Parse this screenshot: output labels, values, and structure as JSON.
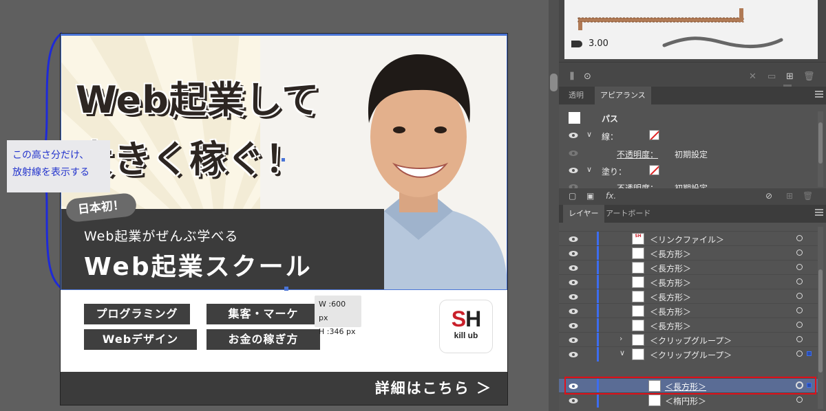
{
  "banner": {
    "headline_line1": "Web起業して",
    "headline_line2": "大きく稼ぐ！",
    "badge": "日本初！",
    "subtext": "Web起業がぜんぶ学べる",
    "school_name": "Web起業スクール",
    "courses": [
      "プログラミング",
      "集客・マーケ",
      "Webデザイン",
      "お金の稼ぎ方"
    ],
    "logo_letters_s": "S",
    "logo_letters_h": "H",
    "logo_sub": "kill ub",
    "details_link": "詳細はこちら ＞"
  },
  "canvas": {
    "size_tooltip_w": "W :600 px",
    "size_tooltip_h": "H :346 px",
    "annotation_line1": "この高さ分だけ、",
    "annotation_line2": "放射線を表示する"
  },
  "brushes": {
    "stroke_size": "3.00"
  },
  "appearance_panel": {
    "tabs": [
      "透明",
      "アピアランス"
    ],
    "active_tab": "アピアランス",
    "object_type": "パス",
    "stroke_label": "線：",
    "opacity_label": "不透明度：",
    "opacity_value": "初期設定",
    "fill_label": "塗り：",
    "opacity2_label": "不透明度：",
    "opacity2_value": "初期設定"
  },
  "layers_panel": {
    "tabs": [
      "レイヤー",
      "アートボード"
    ],
    "active_tab": "レイヤー",
    "rows": [
      {
        "name": "＜リンクファイル＞"
      },
      {
        "name": "＜長方形＞"
      },
      {
        "name": "＜長方形＞"
      },
      {
        "name": "＜長方形＞"
      },
      {
        "name": "＜長方形＞"
      },
      {
        "name": "＜長方形＞"
      },
      {
        "name": "＜長方形＞"
      },
      {
        "name": "＜クリップグループ＞"
      },
      {
        "name": "＜クリップグループ＞"
      },
      {
        "name": "＜長方形＞"
      },
      {
        "name": "＜楕円形＞"
      }
    ],
    "selected_row": "＜長方形＞"
  },
  "colors": {
    "selection_blue": "#4a74d6",
    "highlight_red": "#e0101a",
    "banner_dark": "#3b3b3b",
    "logo_red": "#c9202a",
    "annotation_text": "#2233cc"
  },
  "icons": {
    "eye": "eye-icon",
    "no_color": "none-swatch-icon",
    "chevron": "chevron-down-icon",
    "panel_menu": "hamburger-menu-icon",
    "fx": "fx-icon",
    "delete": "trash-icon",
    "new": "new-item-icon"
  }
}
